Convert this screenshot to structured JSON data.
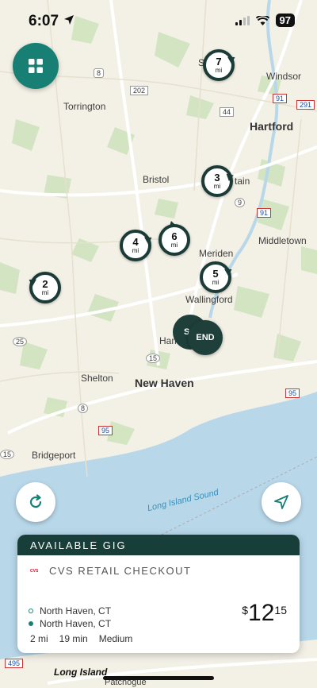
{
  "status_bar": {
    "time": "6:07",
    "battery": "97"
  },
  "map": {
    "labels": {
      "windsor": "Windsor",
      "torrington": "Torrington",
      "hartford": "Hartford",
      "bristol": "Bristol",
      "middletown": "Middletown",
      "meriden": "Meriden",
      "wallingford": "Wallingford",
      "hamden": "Ham",
      "new_haven": "New Haven",
      "shelton": "Shelton",
      "bridgeport": "Bridgeport",
      "long_island_sound": "Long Island Sound",
      "long_island": "Long Island",
      "patchogue": "Patchogue",
      "simsbury_partial": "S",
      "britain_partial": "tain"
    },
    "shields": {
      "r8_top": "8",
      "r202": "202",
      "r44": "44",
      "r91_top": "91",
      "r291": "291",
      "r9": "9",
      "r91_mid": "91",
      "r25": "25",
      "r15": "15",
      "r8_bottom": "8",
      "r95_left": "95",
      "r95_right": "95",
      "r15_left": "15",
      "r495": "495"
    }
  },
  "markers": [
    {
      "distance": "7",
      "unit": "mi"
    },
    {
      "distance": "3",
      "unit": "mi"
    },
    {
      "distance": "6",
      "unit": "mi"
    },
    {
      "distance": "4",
      "unit": "mi"
    },
    {
      "distance": "5",
      "unit": "mi"
    },
    {
      "distance": "2",
      "unit": "mi"
    }
  ],
  "end_marker": {
    "label": "END",
    "start_partial": "S"
  },
  "gig": {
    "header": "AVAILABLE GIG",
    "logo_text": "CVS",
    "title": "CVS RETAIL CHECKOUT",
    "pickup": "North Haven, CT",
    "dropoff": "North Haven, CT",
    "distance": "2 mi",
    "duration": "19 min",
    "effort": "Medium",
    "price_currency": "$",
    "price_whole": "12",
    "price_cents": "15"
  },
  "icons": {
    "menu": "grid-icon",
    "refresh": "refresh-icon",
    "locate": "navigation-arrow-icon"
  },
  "colors": {
    "accent_teal": "#177f74",
    "dark_green": "#173e38",
    "water": "#b8d8ea",
    "land": "#f3f0e6",
    "park": "#cfe3bd"
  }
}
